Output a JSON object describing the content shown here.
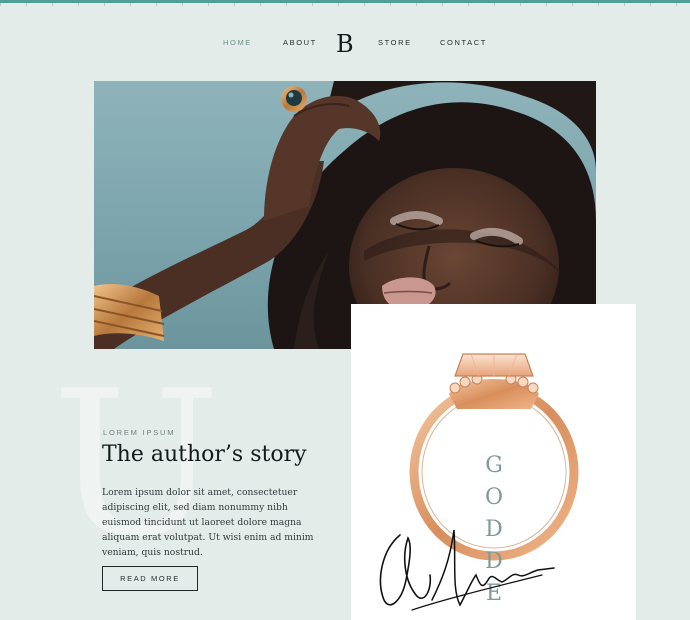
{
  "nav": {
    "items": [
      "HOME",
      "ABOUT",
      "STORE",
      "CONTACT"
    ],
    "logo": "B",
    "active": "HOME"
  },
  "hero": {
    "icon": "portrait-photo"
  },
  "story": {
    "decor_letter": "U",
    "eyebrow": "LOREM IPSUM",
    "title": "The author’s story",
    "body": "Lorem ipsum dolor sit amet, consectetuer adipiscing elit, sed diam nonummy nibh euismod tincidunt ut laoreet dolore magna aliquam erat volutpat. Ut wisi enim ad minim veniam, quis nostrud.",
    "button_label": "READ MORE"
  },
  "product": {
    "vertical_text": "GODDE",
    "icon": "ring-image"
  },
  "signature": {
    "icon": "signature-icon"
  },
  "colors": {
    "background": "#e4ecea",
    "accent": "#4e9f98",
    "ring": "#e2a77d"
  }
}
